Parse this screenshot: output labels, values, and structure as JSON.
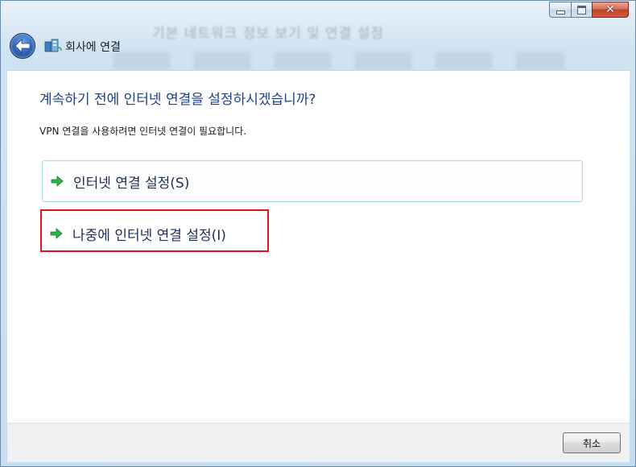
{
  "window": {
    "background_title": "기본 네트워크 정보 보기 및 연결 설정",
    "close_symbol": "✕"
  },
  "header": {
    "title": "회사에 연결"
  },
  "main": {
    "heading": "계속하기 전에 인터넷 연결을 설정하시겠습니까?",
    "description": "VPN 연결을 사용하려면 인터넷 연결이 필요합니다.",
    "options": [
      {
        "label": "인터넷 연결 설정(S)",
        "icon": "green-arrow-icon"
      },
      {
        "label": "나중에 인터넷 연결 설정(I)",
        "icon": "green-arrow-icon"
      }
    ]
  },
  "footer": {
    "cancel_label": "취소"
  },
  "colors": {
    "heading": "#1e3f8c",
    "highlight": "#e0141c",
    "arrow": "#2db34a"
  }
}
